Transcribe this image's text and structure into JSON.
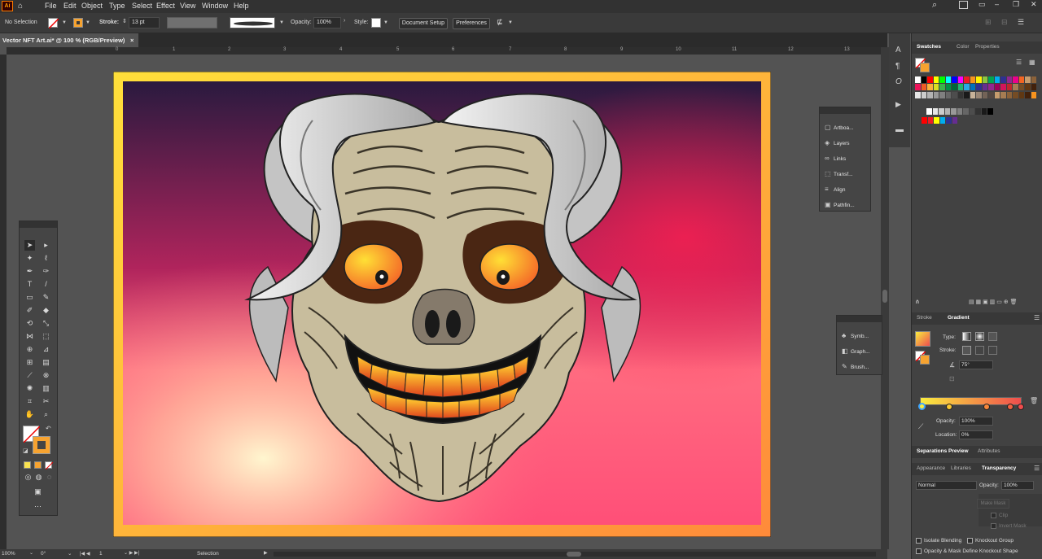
{
  "app": {
    "logo_text": "Ai",
    "menu": [
      "File",
      "Edit",
      "Object",
      "Type",
      "Select",
      "Effect",
      "View",
      "Window",
      "Help"
    ]
  },
  "control_bar": {
    "selection_label": "No Selection",
    "stroke_label": "Stroke:",
    "stroke_value": "13 pt",
    "opacity_label": "Opacity:",
    "opacity_value": "100%",
    "style_label": "Style:",
    "document_setup": "Document Setup",
    "preferences": "Preferences"
  },
  "document_tab": {
    "title": "Vector NFT Art.ai* @ 100 % (RGB/Preview)",
    "close": "×"
  },
  "ruler": {
    "ticks": [
      "0",
      "1",
      "2",
      "3",
      "4",
      "5",
      "6",
      "7",
      "8",
      "9",
      "10",
      "11",
      "12",
      "13"
    ]
  },
  "floating_panel_1": {
    "items": [
      "Artboa...",
      "Layers",
      "Links",
      "Transf...",
      "Align",
      "Pathfin..."
    ]
  },
  "floating_panel_2": {
    "items": [
      "Symb...",
      "Graph...",
      "Brush..."
    ]
  },
  "swatches_panel": {
    "tabs": [
      "Swatches",
      "Color",
      "Properties"
    ],
    "colors_row1": [
      "#ffffff",
      "#000000",
      "#ff0000",
      "#ffff00",
      "#00ff00",
      "#00ffff",
      "#0000ff",
      "#ff00ff",
      "#ed1c24",
      "#f7941d",
      "#fff200",
      "#8dc63f",
      "#00a651",
      "#00aeef",
      "#2e3192",
      "#92278f",
      "#ec008c",
      "#f26522",
      "#c69c6d",
      "#8c6239"
    ],
    "colors_row2": [
      "#ed145b",
      "#f15a24",
      "#fbb03b",
      "#d9e021",
      "#39b54a",
      "#009245",
      "#006837",
      "#22b573",
      "#29abe2",
      "#0071bc",
      "#2e3192",
      "#662d91",
      "#93278f",
      "#9e005d",
      "#d4145a",
      "#c1272d",
      "#a67c52",
      "#754c24",
      "#603813",
      "#42210b"
    ],
    "colors_row3": [
      "#e6e6e6",
      "#cccccc",
      "#b3b3b3",
      "#999999",
      "#808080",
      "#666666",
      "#4d4d4d",
      "#333333",
      "#1a1a1a",
      "#c7b299",
      "#998675",
      "#736357",
      "#534741",
      "#c69c6d",
      "#a67c52",
      "#8c6239",
      "#754c24",
      "#603813",
      "#42210b",
      "#f7931e"
    ],
    "colors_row4": [
      "#ffffff",
      "#e6e6e6",
      "#cccccc",
      "#b3b3b3",
      "#999999",
      "#808080",
      "#666666",
      "#4d4d4d",
      "#333333",
      "#1a1a1a",
      "#000000"
    ],
    "colors_row5": [
      "#ff0000",
      "#ed1c24",
      "#ffff00",
      "#00aeef",
      "#2e3192",
      "#662d91"
    ]
  },
  "gradient_panel": {
    "tabs": [
      "Stroke",
      "Gradient"
    ],
    "type_label": "Type:",
    "stroke_label": "Stroke:",
    "angle_value": "75°",
    "opacity_label": "Opacity:",
    "opacity_value": "100%",
    "location_label": "Location:",
    "location_value": "0%",
    "colors": {
      "start": "#f9ec3e",
      "end": "#f04d4d"
    }
  },
  "separations_panel": {
    "tabs": [
      "Separations Preview",
      "Attributes"
    ]
  },
  "transparency_panel": {
    "tabs": [
      "Appearance",
      "Libraries",
      "Transparency"
    ],
    "blend_mode": "Normal",
    "opacity_label": "Opacity:",
    "opacity_value": "100%",
    "make_mask": "Make Mask",
    "clip": "Clip",
    "invert_mask": "Invert Mask",
    "isolate_blending": "Isolate Blending",
    "knockout_group": "Knockout Group",
    "opacity_mask_label": "Opacity & Mask Define Knockout Shape"
  },
  "status_bar": {
    "zoom": "100%",
    "rotate": "0°",
    "artboard": "1",
    "tool": "Selection"
  },
  "colors": {
    "artboard_gradient_top": "#2d1c40",
    "artboard_gradient_mid": "#e02a5e",
    "artboard_gradient_bottom": "#ff5a78",
    "artboard_glow": "#fff1c2",
    "frame": "#ffcc33",
    "skull": "#c8bd9d",
    "hair": "#d8d8d8",
    "eye_socket": "#4a2613",
    "eye_iris": "#fbb824",
    "nose": "#857a6b"
  }
}
